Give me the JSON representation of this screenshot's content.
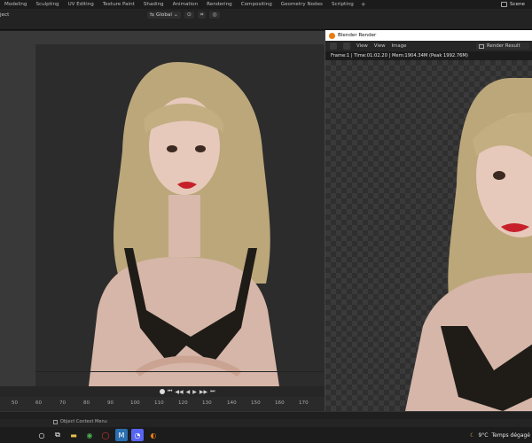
{
  "topbar": {
    "workspaces": [
      "Modeling",
      "Sculpting",
      "UV Editing",
      "Texture Paint",
      "Shading",
      "Animation",
      "Rendering",
      "Compositing",
      "Geometry Nodes",
      "Scripting"
    ],
    "add_label": "+",
    "scene_label": "Scene"
  },
  "header": {
    "mode_label": "ject",
    "orientation_label": "Global"
  },
  "timeline": {
    "ticks": [
      "50",
      "60",
      "70",
      "80",
      "90",
      "100",
      "110",
      "120",
      "130",
      "140",
      "150",
      "160",
      "170"
    ]
  },
  "status": {
    "context_menu_label": "Object Context Menu"
  },
  "render_window": {
    "title": "Blender Render",
    "menu": [
      "View",
      "View",
      "Image"
    ],
    "result_label": "Render Result",
    "info": "Frame:1 | Time:01:02.20 | Mem:1904.34M (Peak 1992.76M)"
  },
  "taskbar": {
    "apps": [
      "search-circle",
      "task-view",
      "file-explorer",
      "chrome",
      "opera",
      "app-m",
      "discord",
      "blender"
    ],
    "temperature": "9°C",
    "weather_text": "Temps dégagé"
  }
}
